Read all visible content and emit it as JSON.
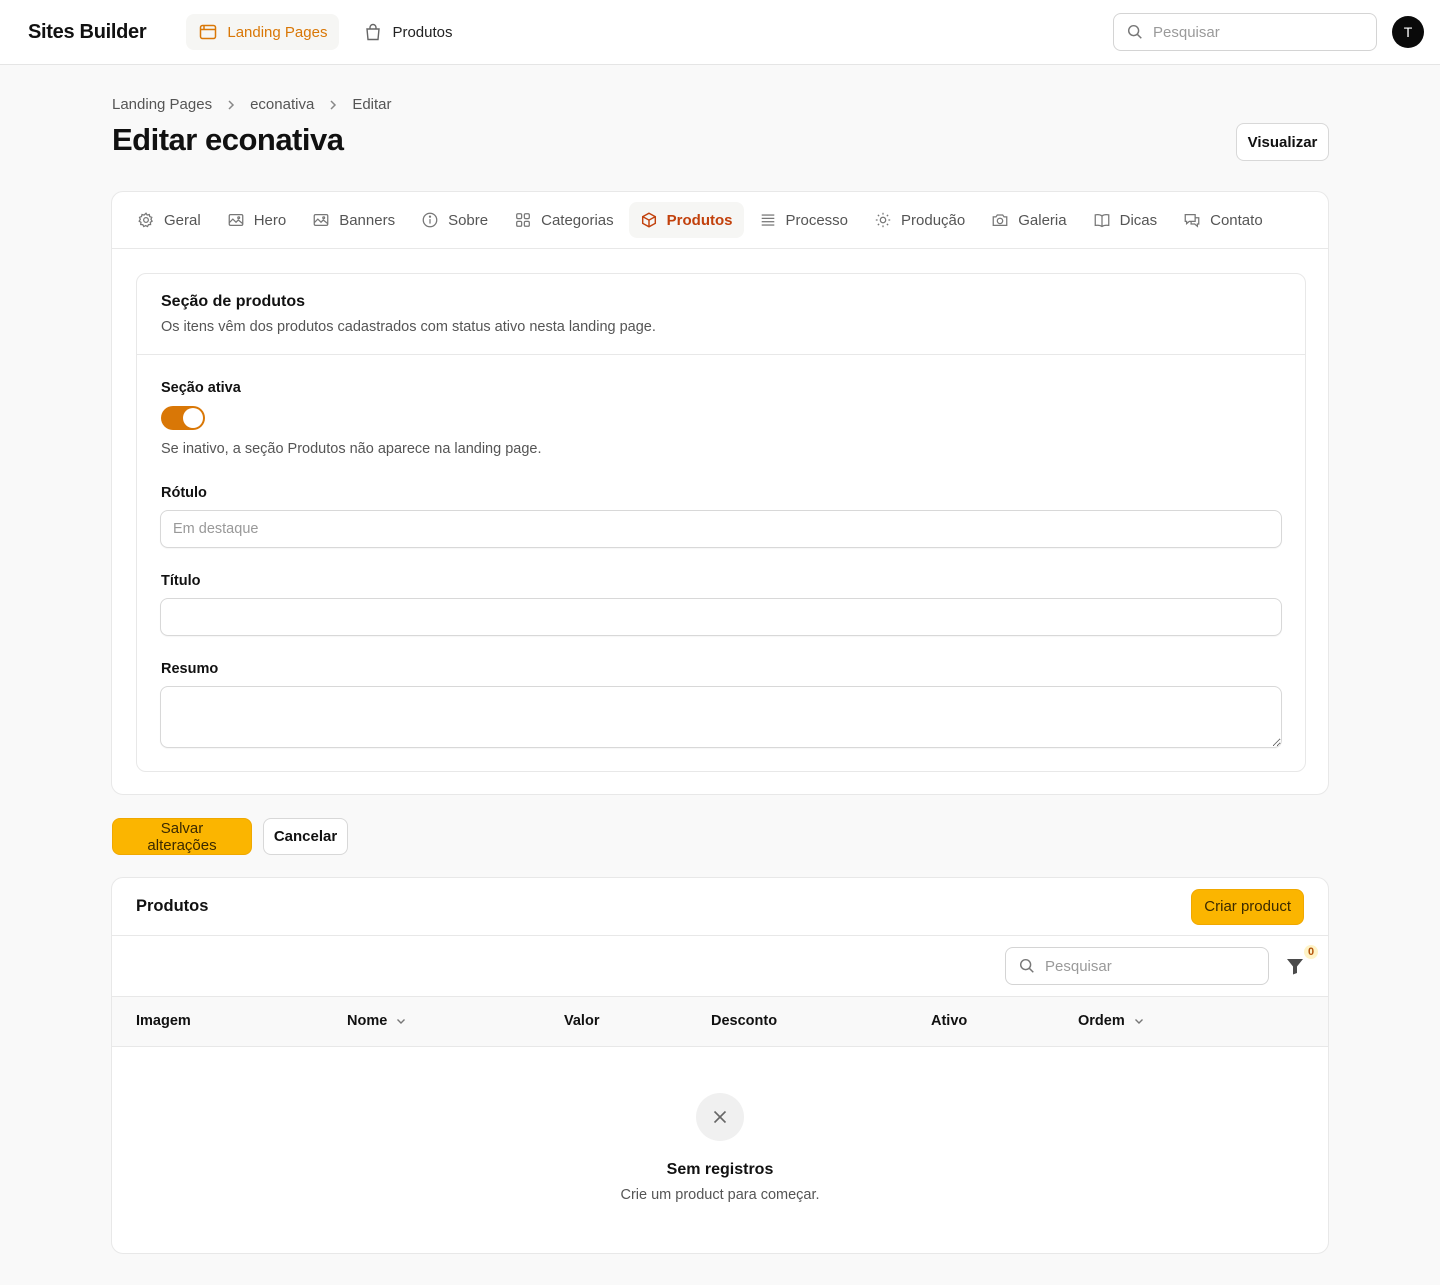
{
  "app": {
    "brand": "Sites Builder"
  },
  "topnav": {
    "items": [
      {
        "label": "Landing Pages",
        "icon": "browser-window-icon",
        "active": true
      },
      {
        "label": "Produtos",
        "icon": "shopping-bag-icon",
        "active": false
      }
    ],
    "search_placeholder": "Pesquisar",
    "avatar_initial": "T"
  },
  "breadcrumb": [
    "Landing Pages",
    "econativa",
    "Editar"
  ],
  "page": {
    "title": "Editar econativa",
    "view_button": "Visualizar"
  },
  "tabs": [
    {
      "label": "Geral",
      "icon": "gear-icon"
    },
    {
      "label": "Hero",
      "icon": "image-icon"
    },
    {
      "label": "Banners",
      "icon": "image-icon"
    },
    {
      "label": "Sobre",
      "icon": "info-icon"
    },
    {
      "label": "Categorias",
      "icon": "grid-icon"
    },
    {
      "label": "Produtos",
      "icon": "cube-icon",
      "active": true
    },
    {
      "label": "Processo",
      "icon": "list-icon"
    },
    {
      "label": "Produção",
      "icon": "sun-icon"
    },
    {
      "label": "Galeria",
      "icon": "camera-icon"
    },
    {
      "label": "Dicas",
      "icon": "book-icon"
    },
    {
      "label": "Contato",
      "icon": "chat-icon"
    }
  ],
  "section": {
    "title": "Seção de produtos",
    "description": "Os itens vêm dos produtos cadastrados com status ativo nesta landing page.",
    "active_label": "Seção ativa",
    "active_value": true,
    "active_hint": "Se inativo, a seção Produtos não aparece na landing page.",
    "rotulo_label": "Rótulo",
    "rotulo_placeholder": "Em destaque",
    "rotulo_value": "",
    "titulo_label": "Título",
    "titulo_value": "",
    "resumo_label": "Resumo",
    "resumo_value": ""
  },
  "actions": {
    "save": "Salvar alterações",
    "cancel": "Cancelar"
  },
  "products_table": {
    "title": "Produtos",
    "create_button": "Criar product",
    "search_placeholder": "Pesquisar",
    "filter_count": "0",
    "columns": [
      {
        "label": "Imagem",
        "sortable": false
      },
      {
        "label": "Nome",
        "sortable": true
      },
      {
        "label": "Valor",
        "sortable": false
      },
      {
        "label": "Desconto",
        "sortable": false
      },
      {
        "label": "Ativo",
        "sortable": false
      },
      {
        "label": "Ordem",
        "sortable": true
      }
    ],
    "rows": [],
    "empty_title": "Sem registros",
    "empty_description": "Crie um product para começar."
  },
  "colors": {
    "accent": "#d97706",
    "primary_button": "#fbb500",
    "active_tab_text": "#c2410c"
  }
}
